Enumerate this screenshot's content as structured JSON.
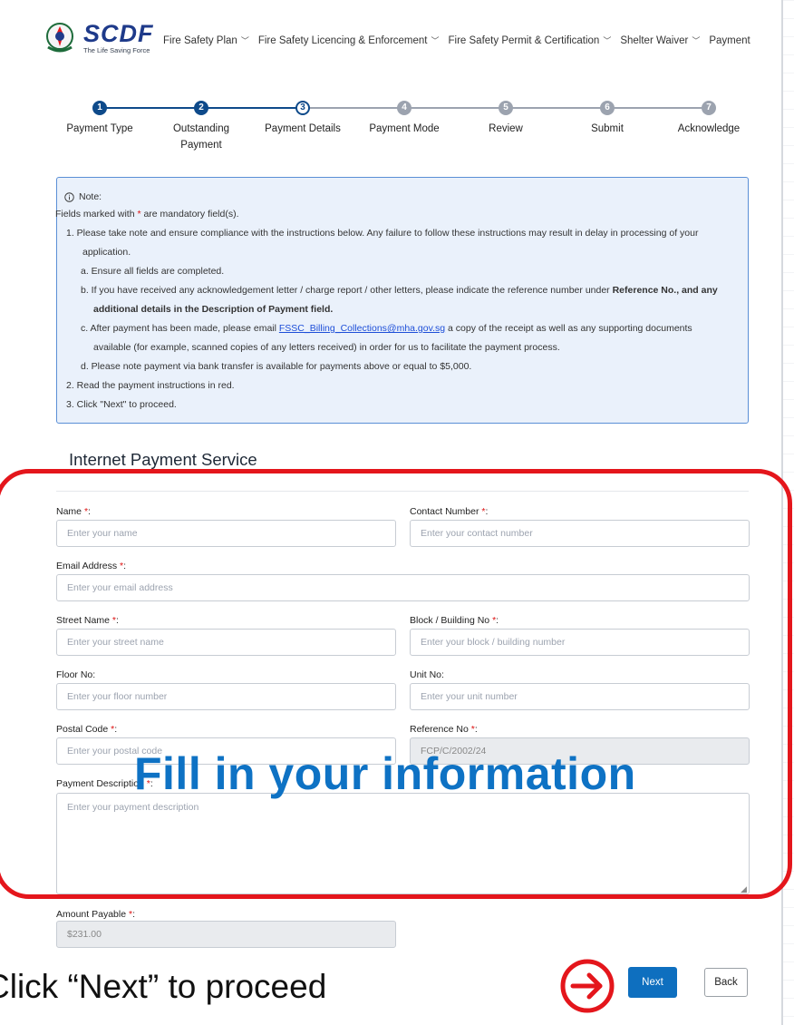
{
  "header": {
    "brand": "SCDF",
    "tagline": "The Life Saving Force",
    "nav": [
      "Fire Safety Plan",
      "Fire Safety Licencing & Enforcement",
      "Fire Safety Permit & Certification",
      "Shelter Waiver",
      "Payment"
    ]
  },
  "stepper": {
    "steps": [
      {
        "num": "1",
        "label": "Payment Type"
      },
      {
        "num": "2",
        "label": "Outstanding Payment"
      },
      {
        "num": "3",
        "label": "Payment Details"
      },
      {
        "num": "4",
        "label": "Payment Mode"
      },
      {
        "num": "5",
        "label": "Review"
      },
      {
        "num": "6",
        "label": "Submit"
      },
      {
        "num": "7",
        "label": "Acknowledge"
      }
    ],
    "current_step": 3
  },
  "note": {
    "title": "Note:",
    "mandatory_pre": "Fields marked with ",
    "star": "*",
    "mandatory_post": " are mandatory field(s).",
    "item1a": "1. Please take note and ensure compliance with the instructions below. Any failure to follow these instructions may result in delay in processing of your",
    "item1b": "application.",
    "a": "a. Ensure all fields are completed.",
    "b1_pre": "b. If you have received any acknowledgement letter / charge report / other letters, please indicate the reference number under ",
    "b1_bold": "Reference No., and any",
    "b2_bold": "additional details in the Description of Payment field.",
    "c1_pre": "c. After payment has been made, please email ",
    "c1_link": "FSSC_Billing_Collections@mha.gov.sg",
    "c1_post": " a copy of the receipt as well as any supporting documents",
    "c2": "available (for example, scanned copies of any letters received) in order for us to facilitate the payment process.",
    "d": "d. Please note payment via bank transfer is available for payments above or equal to $5,000.",
    "item2": "2. Read the payment instructions in red.",
    "item3": "3. Click \"Next\" to proceed."
  },
  "form": {
    "section_title": "Internet Payment Service",
    "name": {
      "label": "Name",
      "placeholder": "Enter your name"
    },
    "contact": {
      "label": "Contact Number",
      "placeholder": "Enter your contact number"
    },
    "email": {
      "label": "Email Address",
      "placeholder": "Enter your email address"
    },
    "street": {
      "label": "Street Name",
      "placeholder": "Enter your street name"
    },
    "block": {
      "label": "Block / Building No",
      "placeholder": "Enter your block / building number"
    },
    "floor": {
      "label": "Floor No:",
      "placeholder": "Enter your floor number"
    },
    "unit": {
      "label": "Unit No:",
      "placeholder": "Enter your unit number"
    },
    "postal": {
      "label": "Postal Code",
      "placeholder": "Enter your postal code"
    },
    "reference": {
      "label": "Reference No",
      "value": "FCP/C/2002/24"
    },
    "description": {
      "label": "Payment Description",
      "placeholder": "Enter your payment description"
    },
    "amount": {
      "label": "Amount Payable",
      "value": "$231.00"
    },
    "required_mark": "*",
    "colon": ":"
  },
  "overlay": {
    "fill_text": "Fill in your information",
    "caption": "Click “Next” to proceed"
  },
  "buttons": {
    "next": "Next",
    "back": "Back"
  },
  "colors": {
    "primary": "#0e4a8a",
    "accent_red": "#e4161c",
    "overlay_blue": "#0e72c4"
  }
}
